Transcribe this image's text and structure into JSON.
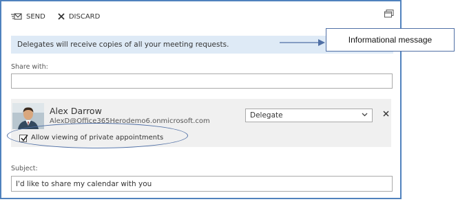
{
  "toolbar": {
    "send_label": "SEND",
    "discard_label": "DISCARD"
  },
  "info_bar": {
    "message": "Delegates will receive copies of all your meeting requests."
  },
  "callout": {
    "text": "Informational message"
  },
  "share": {
    "label": "Share with:",
    "value": "",
    "placeholder": ""
  },
  "delegate": {
    "name": "Alex Darrow",
    "email": "AlexD@Office365Herodemo6.onmicrosoft.com",
    "permission": "Delegate",
    "private_checkbox_label": "Allow viewing of private appointments",
    "private_checked": true
  },
  "subject": {
    "label": "Subject:",
    "value": "I'd like to share my calendar with you"
  },
  "colors": {
    "frame_border": "#4f81bd",
    "info_bg": "#deeaf6",
    "panel_bg": "#f0f0f0"
  },
  "icons": [
    "send-icon",
    "discard-icon",
    "popout-icon",
    "chevron-down-icon",
    "remove-icon",
    "checkmark-icon"
  ]
}
